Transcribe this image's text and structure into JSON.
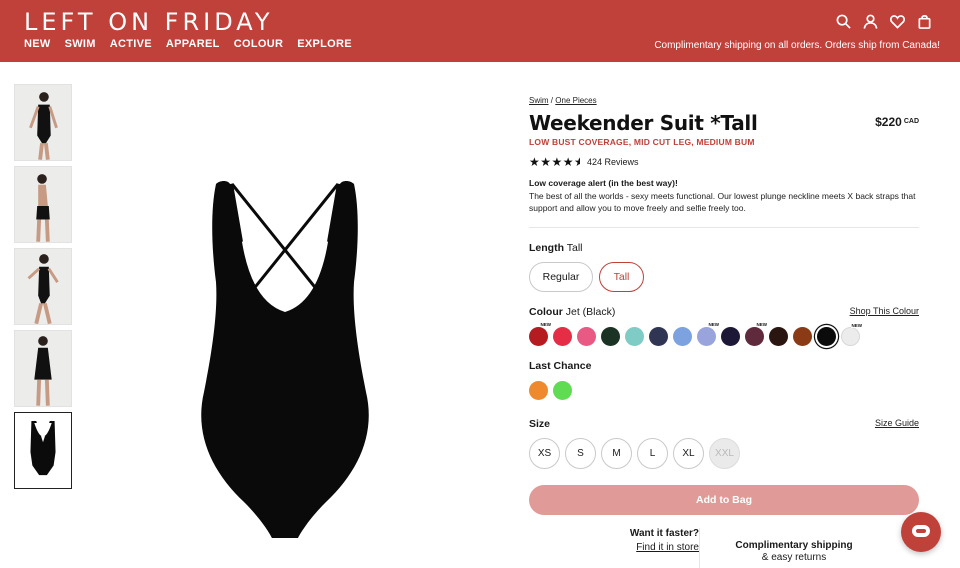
{
  "header": {
    "logo": "LEFT ON FRIDAY",
    "nav": [
      "NEW",
      "SWIM",
      "ACTIVE",
      "APPAREL",
      "COLOUR",
      "EXPLORE"
    ],
    "promo": "Complimentary shipping on all orders. Orders ship from Canada!",
    "icons": [
      "search-icon",
      "account-icon",
      "wishlist-icon",
      "bag-icon"
    ],
    "bg_color": "#c0403a"
  },
  "breadcrumb": {
    "crumb1": "Swim",
    "sep": "/",
    "crumb2": "One Pieces"
  },
  "product": {
    "title": "Weekender Suit *Tall",
    "price": "$220",
    "currency": "CAD",
    "subtitle": "LOW BUST COVERAGE, MID CUT LEG, MEDIUM BUM",
    "rating": 4.5,
    "reviews": "424 Reviews",
    "alert": "Low coverage alert (in the best way)!",
    "description": "The best of all the worlds - sexy meets functional. Our lowest plunge neckline meets X back straps that support and allow you to move freely and selfie freely too."
  },
  "length": {
    "label": "Length",
    "value": "Tall",
    "options": [
      "Regular",
      "Tall"
    ]
  },
  "colour": {
    "label": "Colour",
    "value": "Jet (Black)",
    "link": "Shop This Colour",
    "swatches": [
      "#b51c22",
      "#e52d45",
      "#e85a84",
      "#1a3324",
      "#7fcbc6",
      "#2f3552",
      "#7ca2e0",
      "#9aa4dc",
      "#1c1836",
      "#5e2a3c",
      "#2b1510",
      "#8a3b16",
      "#0b0b0b",
      "#ececec"
    ],
    "new_badge": "NEW",
    "new_flags": [
      true,
      false,
      false,
      false,
      false,
      false,
      false,
      true,
      false,
      true,
      false,
      false,
      false,
      true
    ],
    "selected_index": 12
  },
  "last_chance": {
    "label": "Last Chance",
    "swatches": [
      "#ee8a2d",
      "#5fdc52"
    ]
  },
  "size": {
    "label": "Size",
    "guide": "Size Guide",
    "options": [
      "XS",
      "S",
      "M",
      "L",
      "XL",
      "XXL"
    ],
    "disabled": [
      "XXL"
    ]
  },
  "add_to_bag": "Add to Bag",
  "bottom": {
    "faster_title": "Want it faster?",
    "faster_link": "Find it in store",
    "shipping_title": "Complimentary shipping",
    "shipping_sub": "& easy returns"
  }
}
